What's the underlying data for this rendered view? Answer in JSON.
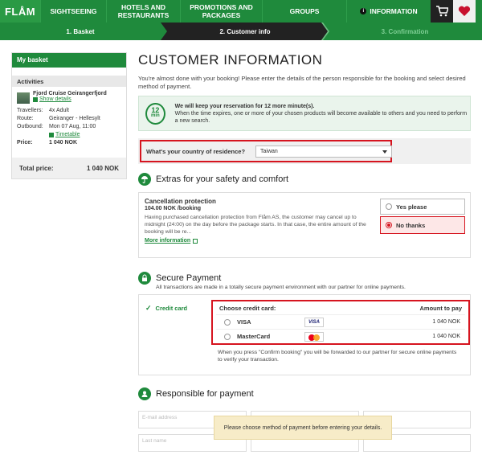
{
  "nav": {
    "logo": "FLÅM",
    "items": [
      "SIGHTSEEING",
      "HOTELS AND RESTAURANTS",
      "PROMOTIONS AND PACKAGES",
      "GROUPS",
      "INFORMATION"
    ]
  },
  "steps": [
    "1. Basket",
    "2. Customer info",
    "3. Confirmation"
  ],
  "basket": {
    "title": "My basket",
    "activities_label": "Activities",
    "product_name": "Fjord Cruise Geirangerfjord",
    "show_details": "Show details",
    "travellers_label": "Travellers:",
    "travellers_value": "4x Adult",
    "route_label": "Route:",
    "route_value": "Geiranger - Hellesylt",
    "outbound_label": "Outbound:",
    "outbound_value": "Mon 07 Aug, 11:00",
    "timetable": "Timetable",
    "price_label": "Price:",
    "price_value": "1 040 NOK",
    "total_label": "Total price:",
    "total_value": "1 040 NOK"
  },
  "main": {
    "title": "CUSTOMER INFORMATION",
    "intro": "You're almost done with your booking! Please enter the details of the person responsible for the booking and select desired method of payment.",
    "timer_num": "12",
    "timer_unit": "min",
    "timer_bold": "We will keep your reservation for 12 more minute(s).",
    "timer_text": "When the time expires, one or more of your chosen products will become available to others and you need to perform a new search.",
    "country_label": "What's your country of residence?",
    "country_value": "Taiwan"
  },
  "extras": {
    "title": "Extras for your safety and comfort",
    "name": "Cancellation protection",
    "price": "104.00 NOK /booking",
    "desc": "Having purchased cancellation protection from Flåm AS, the customer may cancel up to midnight (24:00) on the day before the package starts. In that case, the entire amount of the booking will be re...",
    "more": "More information",
    "yes": "Yes please",
    "no": "No thanks"
  },
  "payment": {
    "title": "Secure Payment",
    "subtitle": "All transactions are made in a totally secure payment environment with our partner for online payments.",
    "method": "Credit card",
    "choose": "Choose credit card:",
    "amount_header": "Amount to pay",
    "cards": [
      {
        "name": "VISA",
        "logo": "VISA",
        "amount": "1 040 NOK"
      },
      {
        "name": "MasterCard",
        "logo": "MasterCard",
        "amount": "1 040 NOK"
      }
    ],
    "note": "When you press \"Confirm booking\" you will be forwarded to our partner for secure online payments to verify your transaction."
  },
  "responsible": {
    "title": "Responsible for payment",
    "email_placeholder": "E-mail address",
    "last_placeholder": "Last name"
  },
  "toast": "Please choose method of payment before entering your details.",
  "colors": {
    "brand": "#1f8a3c",
    "highlight": "#d6141f",
    "dark_step": "#222222"
  }
}
